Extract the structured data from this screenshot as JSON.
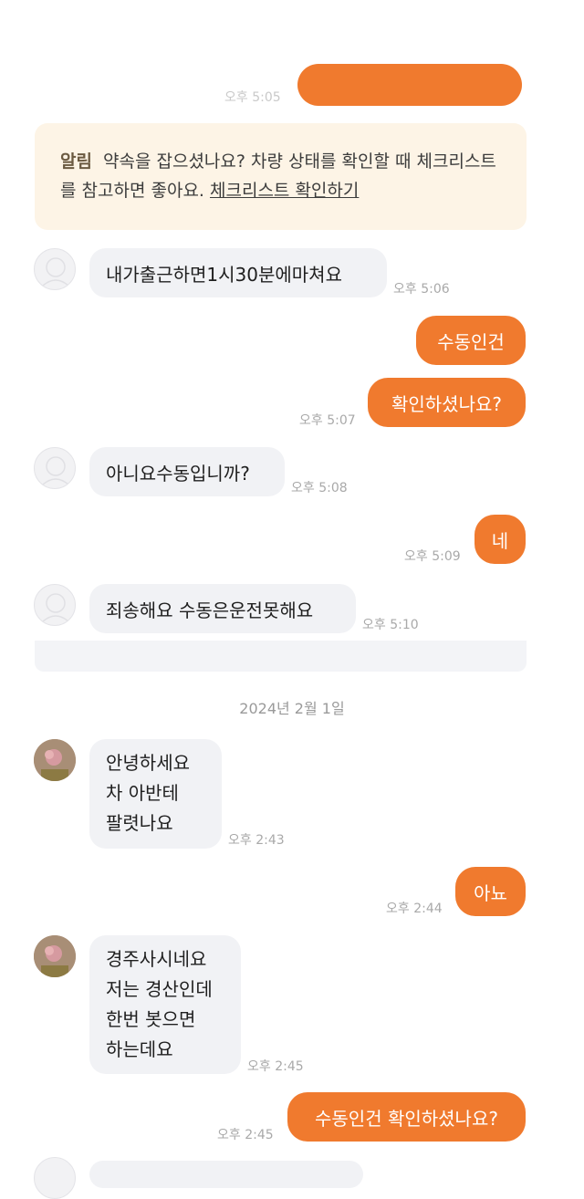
{
  "top_partial": {
    "time": "오후 5:05"
  },
  "notice": {
    "label": "알림",
    "text": "약속을 잡으셨나요? 차량 상태를 확인할 때 체크리스트를 참고하면 좋아요.",
    "link": "체크리스트 확인하기"
  },
  "date_separator": "2024년 2월 1일",
  "messages": [
    {
      "side": "in",
      "text": "내가출근하면1시30분에마쳐요",
      "time": "오후 5:06"
    },
    {
      "side": "out",
      "text": "수동인건",
      "time": ""
    },
    {
      "side": "out",
      "text": "확인하셨나요?",
      "time": "오후 5:07"
    },
    {
      "side": "in",
      "text": "아니요수동입니까?",
      "time": "오후 5:08"
    },
    {
      "side": "out",
      "text": "네",
      "time": "오후 5:09"
    },
    {
      "side": "in",
      "text": "죄송해요 수동은운전못해요",
      "time": "오후 5:10"
    },
    {
      "side": "in",
      "text": "안녕하세요\n차 아반테\n팔렷나요",
      "time": "오후 2:43"
    },
    {
      "side": "out",
      "text": "아뇨",
      "time": "오후 2:44"
    },
    {
      "side": "in",
      "text": "경주사시네요\n저는 경산인데\n한번 봇으면\n하는데요",
      "time": "오후 2:45"
    },
    {
      "side": "out",
      "text": "수동인건 확인하셨나요?",
      "time": "오후 2:45"
    }
  ],
  "colors": {
    "accent": "#f07a2e",
    "incoming_bubble": "#f1f2f5",
    "notice_bg": "#fdf4e6"
  }
}
